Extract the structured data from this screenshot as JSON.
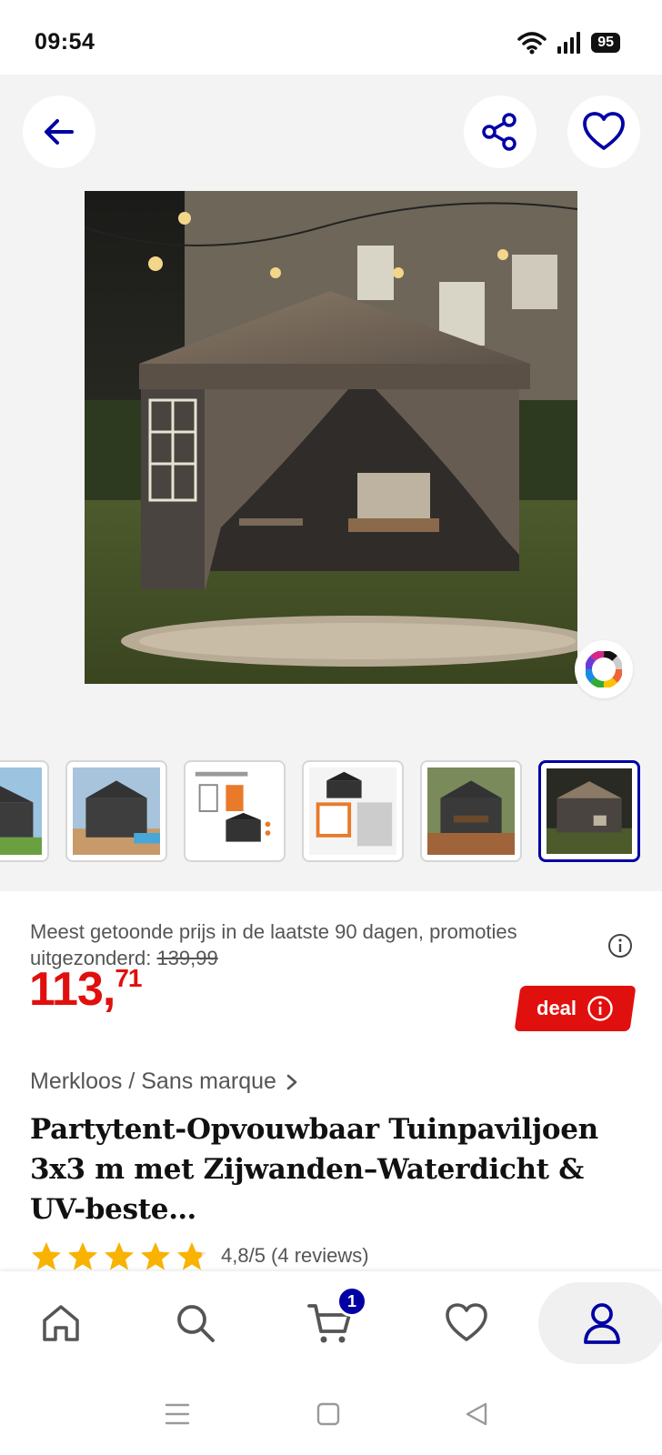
{
  "status_bar": {
    "time": "09:54",
    "battery": "95",
    "icons": [
      "wifi-icon",
      "signal-icon",
      "battery-icon"
    ]
  },
  "gallery": {
    "back_icon": "arrow-left-icon",
    "share_icon": "share-icon",
    "favorite_icon": "heart-icon",
    "color_picker_icon": "color-wheel-icon",
    "thumbnail_count": 6,
    "active_thumbnail": 6
  },
  "pricing": {
    "lowest_price_label": "Meest getoonde prijs in de laatste 90 dagen, promoties uitgezonderd: ",
    "lowest_price_value": "139,99",
    "price_whole": "113,",
    "price_decimal": "71",
    "deal_label": "deal"
  },
  "product": {
    "brand": "Merkloos / Sans marque",
    "title": "Partytent-Opvouwbaar Tuinpaviljoen 3x3 m met Zijwanden–Waterdicht & UV-beste…",
    "rating_value": 4.8,
    "rating_text": "4,8/5 (4 reviews)"
  },
  "bottom_nav": {
    "items": [
      "home-icon",
      "search-icon",
      "cart-icon",
      "heart-icon",
      "account-icon"
    ],
    "cart_count": "1"
  },
  "colors": {
    "brand_blue": "#0000a4",
    "price_red": "#e0100e",
    "star_yellow": "#f9b200"
  }
}
